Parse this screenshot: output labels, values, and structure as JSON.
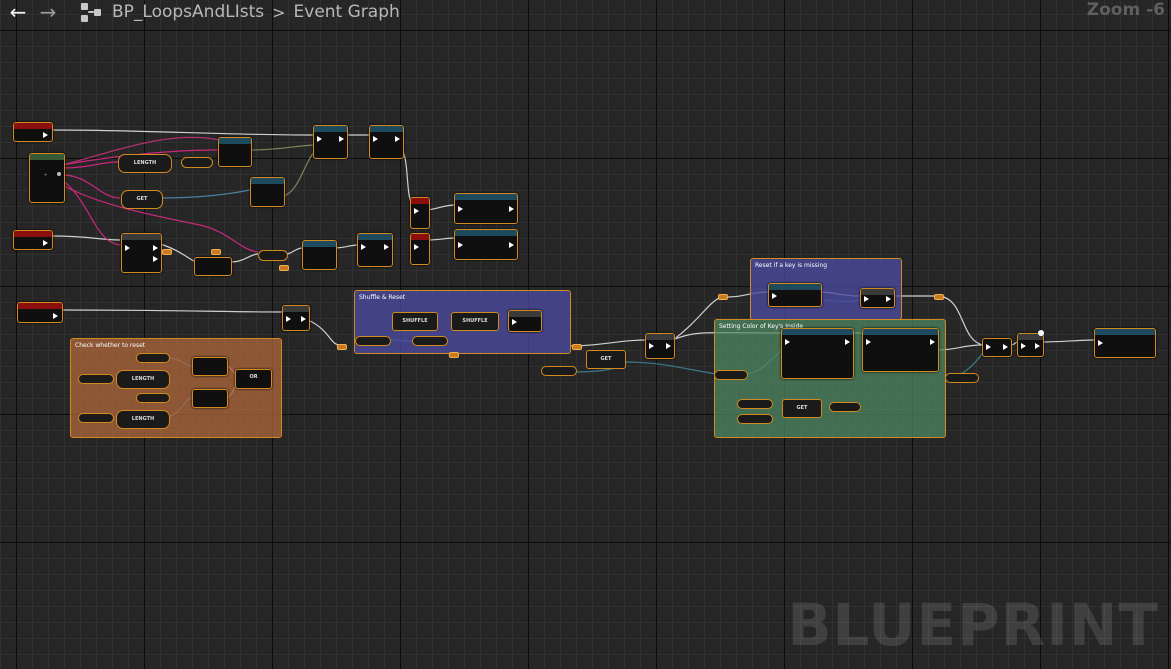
{
  "header": {
    "back_icon": "arrow-left-icon",
    "forward_icon": "arrow-right-icon",
    "graph_icon": "graph-hierarchy-icon",
    "blueprint_name": "BP_LoopsAndLIsts",
    "separator": ">",
    "graph_name": "Event Graph",
    "zoom_label": "Zoom -6"
  },
  "watermark": "BLUEPRINT",
  "comments": {
    "check_reset": "Check whether to reset",
    "shuffle_reset": "Shuffle & Reset",
    "reset_missing": "Reset if a key is missing",
    "setting_color": "Setting Color of Key's Inside"
  },
  "nodes": {
    "length_1": "LENGTH",
    "get_1": "GET",
    "length_2": "LENGTH",
    "length_3": "LENGTH",
    "or_node": "OR",
    "shuffle_1": "SHUFFLE",
    "shuffle_2": "SHUFFLE",
    "get_2": "GET",
    "get_3": "GET"
  },
  "colors": {
    "node_border": "#d28a1e",
    "event_header": "#8a1010",
    "function_header": "#1e4a5e",
    "comment_orange": "#b56a3c",
    "comment_blue": "#4a4aa0",
    "comment_green": "#4f8a63",
    "wire_exec": "#ffffff",
    "wire_array": "#d02080"
  }
}
